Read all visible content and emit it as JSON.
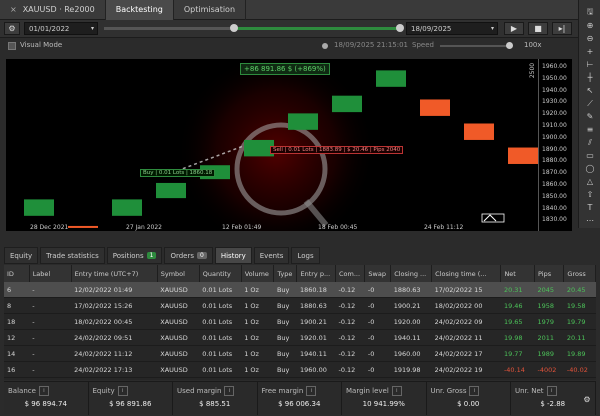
{
  "top_tabs": [
    {
      "label": "XAUUSD · Re2000",
      "active": false
    },
    {
      "label": "Backtesting",
      "active": true
    },
    {
      "label": "Optimisation",
      "active": false
    }
  ],
  "controls": {
    "start_date": "01/01/2022",
    "end_date": "18/09/2025"
  },
  "visual": {
    "label": "Visual Mode",
    "timestamp": "18/09/2025 21:15:01",
    "speed_label": "Speed",
    "speed_value": "100x"
  },
  "chart": {
    "equity_label": "+86 891.86 $ (+869%)",
    "y_ticks": [
      "1960.00",
      "1950.00",
      "1940.00",
      "1930.00",
      "1920.00",
      "1910.00",
      "1900.00",
      "1890.00",
      "1880.00",
      "1870.00",
      "1860.00",
      "1850.00",
      "1840.00",
      "1830.00"
    ],
    "period_label": "2500",
    "x_ticks": [
      "28 Dec 2021",
      "27 Jan 2022",
      "12 Feb 01:49",
      "18 Feb 00:45",
      "24 Feb 11:12"
    ],
    "order_label": "Buy | 0.01 Lots | 1860.18",
    "pos_line_label": "Sell | 0.01 Lots | 1883.89 | $ 20.46 | Pips 2040",
    "candles": [
      {
        "dir": "up",
        "open": 1838,
        "close": 1851
      },
      {
        "dir": "down",
        "open": 1830,
        "close": 1829
      },
      {
        "dir": "up",
        "open": 1838,
        "close": 1851
      },
      {
        "dir": "up",
        "open": 1852,
        "close": 1864
      },
      {
        "dir": "up",
        "open": 1867,
        "close": 1878
      },
      {
        "dir": "up",
        "open": 1885,
        "close": 1898
      },
      {
        "dir": "up",
        "open": 1906,
        "close": 1919
      },
      {
        "dir": "up",
        "open": 1920,
        "close": 1933
      },
      {
        "dir": "up",
        "open": 1940,
        "close": 1953
      },
      {
        "dir": "down",
        "open": 1930,
        "close": 1917
      },
      {
        "dir": "down",
        "open": 1911,
        "close": 1898
      },
      {
        "dir": "down",
        "open": 1892,
        "close": 1879
      }
    ]
  },
  "bottom_tabs": [
    {
      "label": "Equity"
    },
    {
      "label": "Trade statistics"
    },
    {
      "label": "Positions",
      "badge": "1"
    },
    {
      "label": "Orders",
      "badge": "0"
    },
    {
      "label": "History",
      "active": true
    },
    {
      "label": "Events"
    },
    {
      "label": "Logs"
    }
  ],
  "table": {
    "headers": [
      "ID",
      "Label",
      "Entry time (UTC+7)",
      "Symbol",
      "Quantity",
      "Volume",
      "Type",
      "Entry p...",
      "Com...",
      "Swap",
      "Closing ...",
      "Closing time (...",
      "Net",
      "Pips",
      "Gross"
    ],
    "rows": [
      [
        "6",
        "-",
        "12/02/2022 01:49",
        "XAUUSD",
        "0.01 Lots",
        "1 Oz",
        "Buy",
        "1860.18",
        "-0.12",
        "-0",
        "1880.63",
        "17/02/2022 15",
        "20.31",
        "2045",
        "20.45"
      ],
      [
        "8",
        "-",
        "17/02/2022 15:26",
        "XAUUSD",
        "0.01 Lots",
        "1 Oz",
        "Buy",
        "1880.63",
        "-0.12",
        "-0",
        "1900.21",
        "18/02/2022 00",
        "19.46",
        "1958",
        "19.58"
      ],
      [
        "18",
        "-",
        "18/02/2022 00:45",
        "XAUUSD",
        "0.01 Lots",
        "1 Oz",
        "Buy",
        "1900.21",
        "-0.12",
        "-0",
        "1920.00",
        "24/02/2022 09",
        "19.65",
        "1979",
        "19.79"
      ],
      [
        "12",
        "-",
        "24/02/2022 09:51",
        "XAUUSD",
        "0.01 Lots",
        "1 Oz",
        "Buy",
        "1920.01",
        "-0.12",
        "-0",
        "1940.11",
        "24/02/2022 11",
        "19.98",
        "2011",
        "20.11"
      ],
      [
        "14",
        "-",
        "24/02/2022 11:12",
        "XAUUSD",
        "0.01 Lots",
        "1 Oz",
        "Buy",
        "1940.11",
        "-0.12",
        "-0",
        "1960.00",
        "24/02/2022 17",
        "19.77",
        "1989",
        "19.89"
      ],
      [
        "16",
        "-",
        "24/02/2022 17:13",
        "XAUUSD",
        "0.01 Lots",
        "1 Oz",
        "Buy",
        "1960.00",
        "-0.12",
        "-0",
        "1919.98",
        "24/02/2022 19",
        "-40.14",
        "-4002",
        "-40.02"
      ]
    ],
    "selected_row": 0
  },
  "summary": [
    {
      "label": "Balance",
      "value": "$ 96 894.74"
    },
    {
      "label": "Equity",
      "value": "$ 96 891.86"
    },
    {
      "label": "Used margin",
      "value": "$ 885.51"
    },
    {
      "label": "Free margin",
      "value": "$ 96 006.34"
    },
    {
      "label": "Margin level",
      "value": "10 941.99%"
    },
    {
      "label": "Unr. Gross",
      "value": "$ 0.00"
    },
    {
      "label": "Unr. Net",
      "value": "$ -2.88"
    }
  ],
  "colors": {
    "up": "#1f8f3a",
    "down": "#f05a28",
    "accent": "#2e8b3e"
  }
}
